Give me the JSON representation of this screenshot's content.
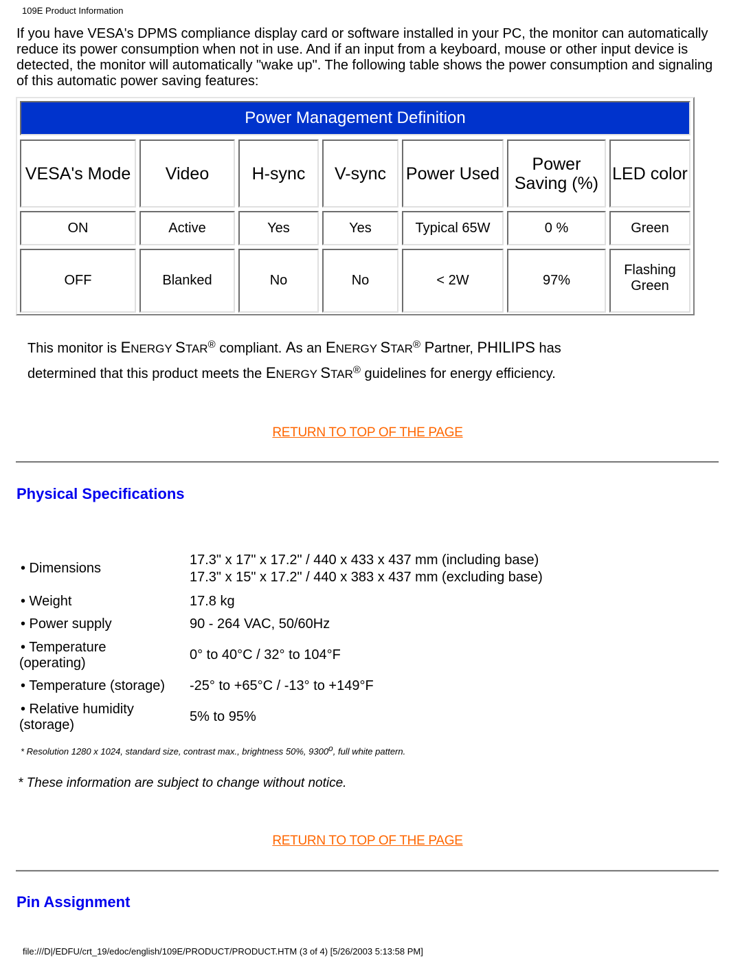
{
  "page_header": "109E Product Information",
  "intro_text": "If you have VESA's DPMS compliance display card or software installed in your PC, the monitor can automatically reduce its power consumption when not in use. And if an input from a keyboard, mouse or other input device is detected, the monitor will automatically \"wake up\". The following table shows the power consumption and signaling of this automatic power saving features:",
  "power_table": {
    "title": "Power Management Definition",
    "title_bg_color": "#0033cc",
    "headers": [
      "VESA's Mode",
      "Video",
      "H-sync",
      "V-sync",
      "Power Used",
      [
        "Power",
        "Saving (%)"
      ],
      "LED color"
    ],
    "rows": [
      {
        "mode": "ON",
        "video": "Active",
        "hsync": "Yes",
        "vsync": "Yes",
        "power_used": "Typical 65W",
        "power_saving": "0 %",
        "led_color": [
          "Green"
        ]
      },
      {
        "mode": "OFF",
        "video": "Blanked",
        "hsync": "No",
        "vsync": "No",
        "power_used": "< 2W",
        "power_saving": "97%",
        "led_color": [
          "Flashing",
          "Green"
        ]
      }
    ]
  },
  "energy_star": {
    "line1_part1": "This monitor is ",
    "es_E": "E",
    "es_NERGY": "NERGY ",
    "es_S": "S",
    "es_TAR": "TAR",
    "reg": "®",
    "line1_part2": " compliant. ",
    "as_A": "A",
    "as_rest": "s an ",
    "partner_P": "P",
    "partner_rest": "artner, ",
    "philips": "PHILIPS",
    "line1_part3": " has",
    "line2_part1": "determined that this product meets the ",
    "line2_part2": " guidelines for energy efficiency."
  },
  "links": {
    "return_to_top": "RETURN TO TOP OF THE PAGE",
    "link_color": "#ff6600"
  },
  "sections": {
    "physical_specs_title": "Physical Specifications",
    "pin_assignment_title": "Pin Assignment",
    "heading_color": "#0000ee"
  },
  "physical_specs": [
    {
      "label": [
        "• Dimensions"
      ],
      "value": [
        "17.3\" x 17\" x 17.2\" / 440 x 433 x 437 mm (including base)",
        "17.3\" x 15\" x 17.2\" / 440 x 383 x 437 mm (excluding base)"
      ]
    },
    {
      "label": [
        "• Weight"
      ],
      "value": [
        "17.8 kg"
      ]
    },
    {
      "label": [
        "• Power supply"
      ],
      "value": [
        "90 - 264 VAC, 50/60Hz"
      ]
    },
    {
      "label": [
        "• Temperature",
        "(operating)"
      ],
      "value": [
        "0° to 40°C / 32° to 104°F"
      ]
    },
    {
      "label": [
        "• Temperature (storage)"
      ],
      "value": [
        "-25° to +65°C / -13° to +149°F"
      ]
    },
    {
      "label": [
        "• Relative humidity",
        "(storage)"
      ],
      "value": [
        "5% to 95%"
      ]
    }
  ],
  "footnote": {
    "text_before": "* Resolution 1280 x 1024, standard size, contrast max., brightness 50%, 9300",
    "degree": "o",
    "text_after": ", full white pattern."
  },
  "notice": "* These information are subject to change without notice.",
  "page_footer": "file:///D|/EDFU/crt_19/edoc/english/109E/PRODUCT/PRODUCT.HTM (3 of 4) [5/26/2003 5:13:58 PM]"
}
